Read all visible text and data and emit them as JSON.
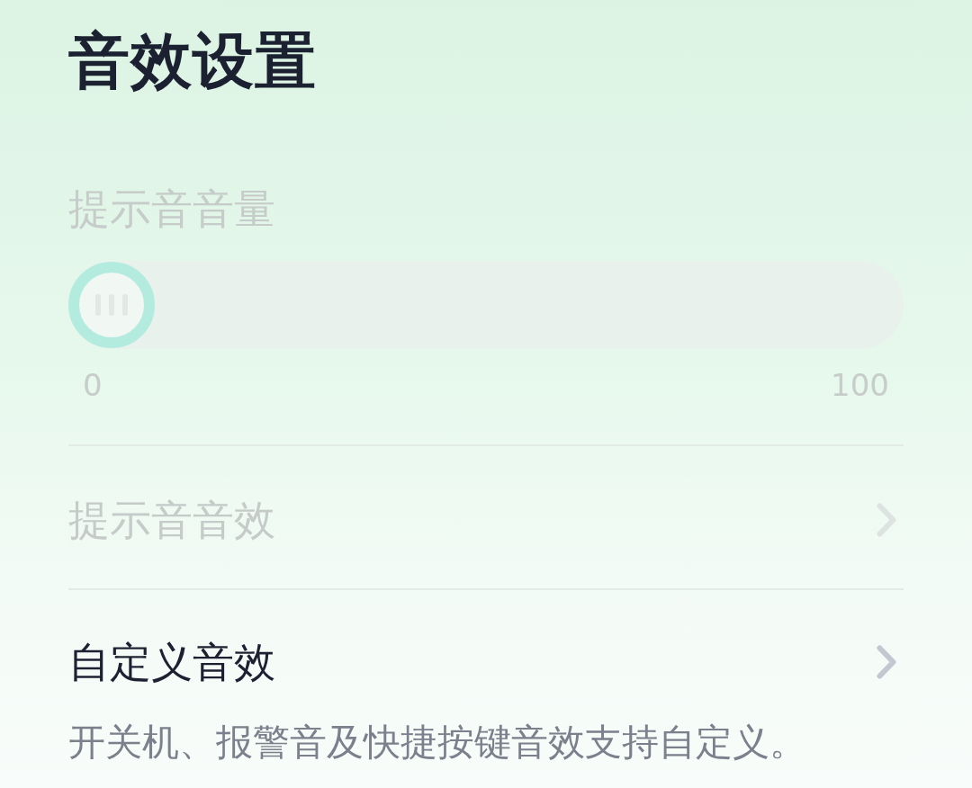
{
  "title": "音效设置",
  "volume": {
    "label": "提示音音量",
    "disabled": true,
    "level": 0,
    "min_label": "0",
    "max_label": "100"
  },
  "rows": [
    {
      "label": "提示音音效",
      "disabled": true
    },
    {
      "label": "自定义音效",
      "disabled": false,
      "description": "开关机、报警音及快捷按键音效支持自定义。"
    }
  ]
}
